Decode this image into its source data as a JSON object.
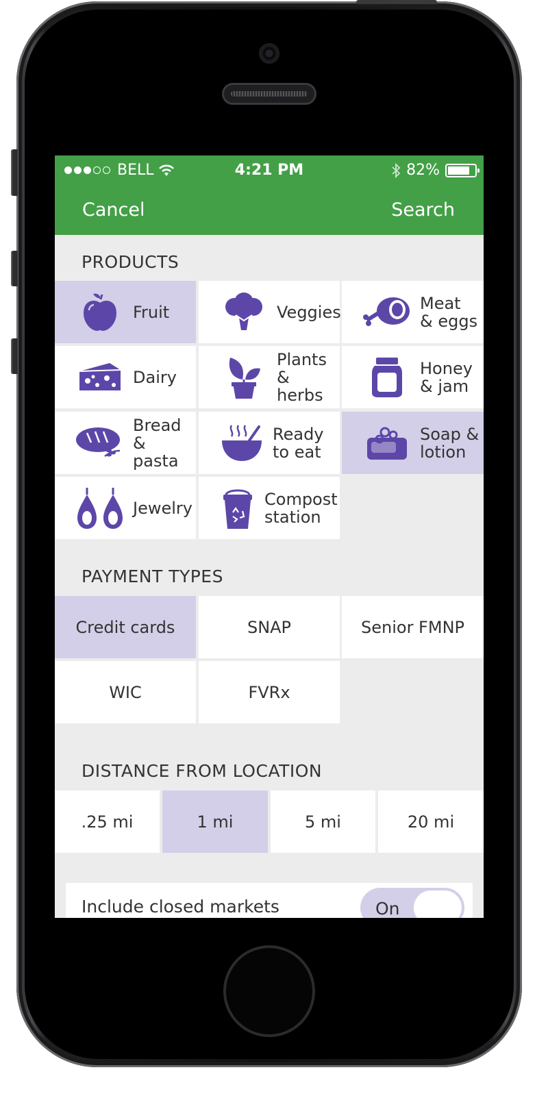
{
  "status_bar": {
    "carrier": "BELL",
    "signal_filled": 3,
    "signal_total": 5,
    "time": "4:21 PM",
    "battery": "82%",
    "battery_level": 0.82
  },
  "nav": {
    "cancel": "Cancel",
    "search": "Search"
  },
  "colors": {
    "accent_green": "#43a047",
    "icon_purple": "#5c47a8",
    "selected_bg": "#d3cfe8"
  },
  "products": {
    "title": "PRODUCTS",
    "items": [
      {
        "l1": "Fruit",
        "l2": "",
        "icon": "apple-icon",
        "selected": true
      },
      {
        "l1": "Veggies",
        "l2": "",
        "icon": "broccoli-icon",
        "selected": false
      },
      {
        "l1": "Meat",
        "l2": "& eggs",
        "icon": "ham-icon",
        "selected": false
      },
      {
        "l1": "Dairy",
        "l2": "",
        "icon": "cheese-icon",
        "selected": false
      },
      {
        "l1": "Plants",
        "l2": "& herbs",
        "icon": "plant-icon",
        "selected": false
      },
      {
        "l1": "Honey",
        "l2": "& jam",
        "icon": "jar-icon",
        "selected": false
      },
      {
        "l1": "Bread",
        "l2": "& pasta",
        "icon": "bread-icon",
        "selected": false
      },
      {
        "l1": "Ready",
        "l2": "to eat",
        "icon": "soup-bowl-icon",
        "selected": false
      },
      {
        "l1": "Soap &",
        "l2": "lotion",
        "icon": "soap-icon",
        "selected": true
      },
      {
        "l1": "Jewelry",
        "l2": "",
        "icon": "earrings-icon",
        "selected": false
      },
      {
        "l1": "Compost",
        "l2": "station",
        "icon": "compost-bin-icon",
        "selected": false
      }
    ]
  },
  "payment_types": {
    "title": "PAYMENT TYPES",
    "items": [
      {
        "label": "Credit cards",
        "selected": true
      },
      {
        "label": "SNAP",
        "selected": false
      },
      {
        "label": "Senior FMNP",
        "selected": false
      },
      {
        "label": "WIC",
        "selected": false
      },
      {
        "label": "FVRx",
        "selected": false
      }
    ]
  },
  "distance": {
    "title": "DISTANCE FROM LOCATION",
    "items": [
      {
        "label": ".25 mi",
        "selected": false
      },
      {
        "label": "1 mi",
        "selected": true
      },
      {
        "label": "5 mi",
        "selected": false
      },
      {
        "label": "20 mi",
        "selected": false
      }
    ]
  },
  "closed_markets": {
    "label": "Include closed markets",
    "value": "On"
  }
}
